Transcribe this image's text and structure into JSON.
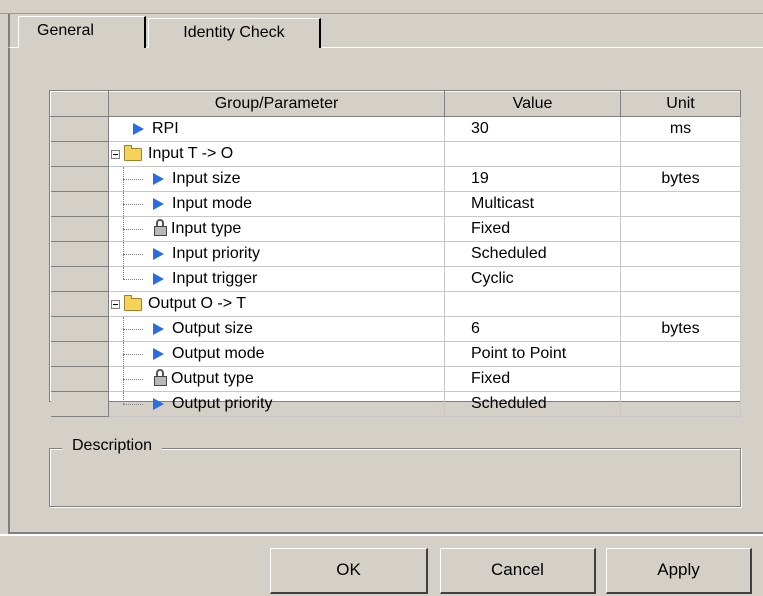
{
  "tabs": [
    "General",
    "Identity Check"
  ],
  "grid": {
    "columns": [
      "Group/Parameter",
      "Value",
      "Unit"
    ],
    "rows": [
      {
        "name": "RPI",
        "value": "30",
        "unit": "ms",
        "icon": "blue-triangle-icon",
        "level": 0
      },
      {
        "name": "Input T -> O",
        "value": "",
        "unit": "",
        "icon": "folder-icon",
        "level": "group"
      },
      {
        "name": "Input size",
        "value": "19",
        "unit": "bytes",
        "icon": "blue-triangle-icon",
        "level": 1
      },
      {
        "name": "Input mode",
        "value": "Multicast",
        "unit": "",
        "icon": "blue-triangle-icon",
        "level": 1
      },
      {
        "name": "Input type",
        "value": "Fixed",
        "unit": "",
        "icon": "lock-icon",
        "level": 1
      },
      {
        "name": "Input priority",
        "value": "Scheduled",
        "unit": "",
        "icon": "blue-triangle-icon",
        "level": 1
      },
      {
        "name": "Input trigger",
        "value": "Cyclic",
        "unit": "",
        "icon": "blue-triangle-icon",
        "level": 1
      },
      {
        "name": "Output O -> T",
        "value": "",
        "unit": "",
        "icon": "folder-icon",
        "level": "group"
      },
      {
        "name": "Output size",
        "value": "6",
        "unit": "bytes",
        "icon": "blue-triangle-icon",
        "level": 1
      },
      {
        "name": "Output mode",
        "value": "Point to Point",
        "unit": "",
        "icon": "blue-triangle-icon",
        "level": 1
      },
      {
        "name": "Output type",
        "value": "Fixed",
        "unit": "",
        "icon": "lock-icon",
        "level": 1
      },
      {
        "name": "Output priority",
        "value": "Scheduled",
        "unit": "",
        "icon": "blue-triangle-icon",
        "level": 1
      }
    ]
  },
  "description": {
    "label": "Description"
  },
  "buttons": {
    "ok": "OK",
    "cancel": "Cancel",
    "apply": "Apply"
  }
}
